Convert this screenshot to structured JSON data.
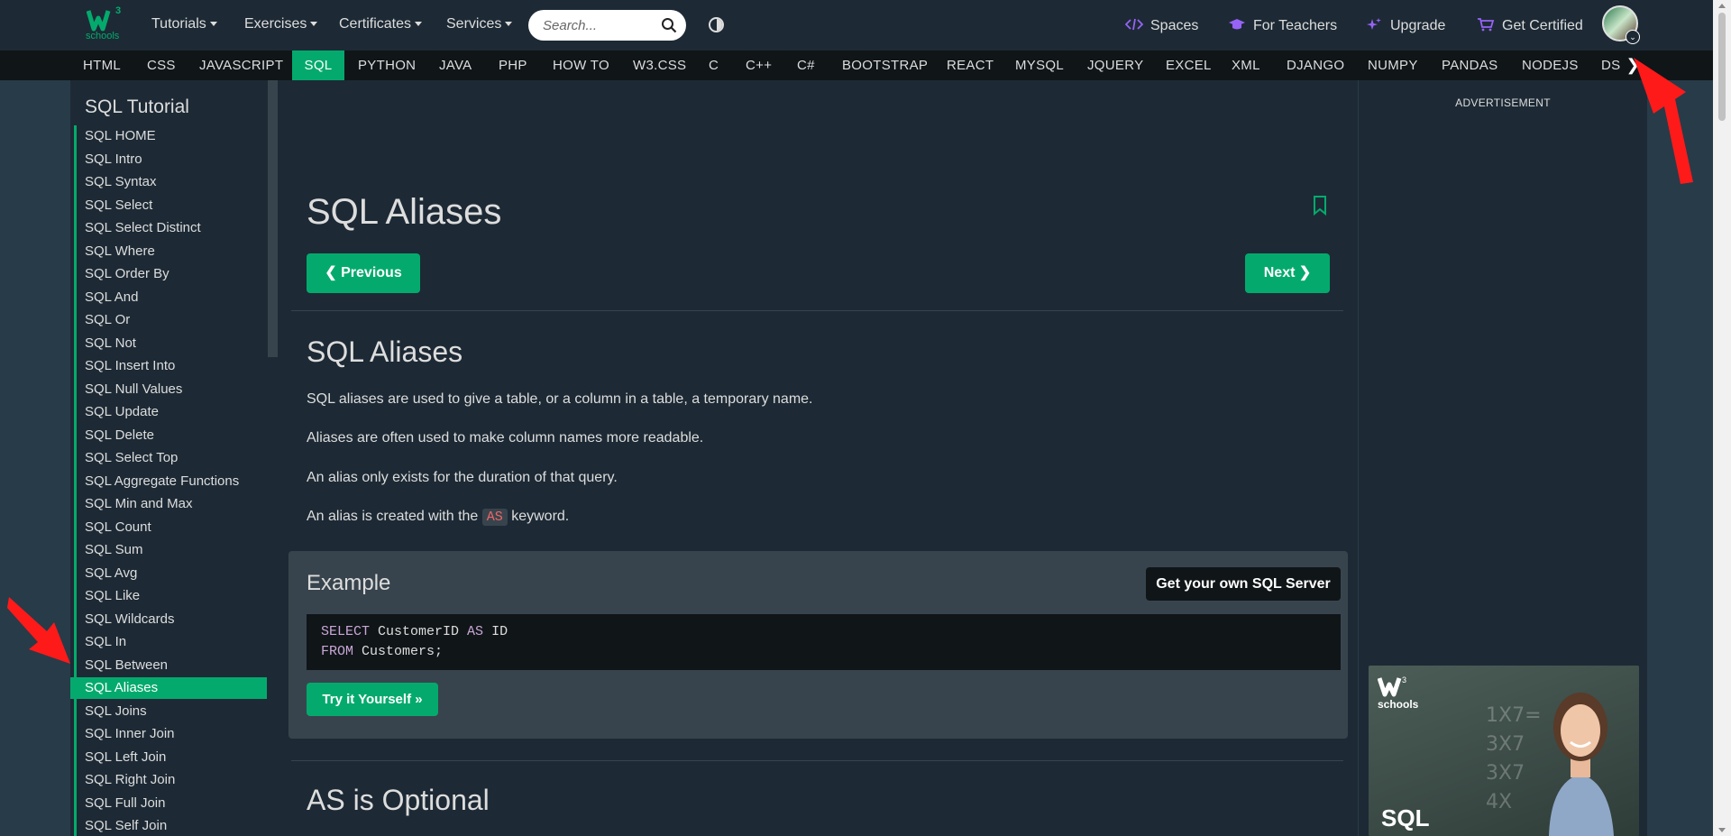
{
  "topnav": {
    "tutorials": "Tutorials",
    "exercises": "Exercises",
    "certificates": "Certificates",
    "services": "Services",
    "search_placeholder": "Search...",
    "spaces": "Spaces",
    "for_teachers": "For Teachers",
    "upgrade": "Upgrade",
    "get_certified": "Get Certified",
    "logo_sup": "3",
    "logo_text": "schools"
  },
  "langbar": {
    "items": [
      "HTML",
      "CSS",
      "JAVASCRIPT",
      "SQL",
      "PYTHON",
      "JAVA",
      "PHP",
      "HOW TO",
      "W3.CSS",
      "C",
      "C++",
      "C#",
      "BOOTSTRAP",
      "REACT",
      "MYSQL",
      "JQUERY",
      "EXCEL",
      "XML",
      "DJANGO",
      "NUMPY",
      "PANDAS",
      "NODEJS",
      "DS"
    ],
    "active": "SQL",
    "next_glyph": "❯"
  },
  "sidebar": {
    "title": "SQL Tutorial",
    "items": [
      "SQL HOME",
      "SQL Intro",
      "SQL Syntax",
      "SQL Select",
      "SQL Select Distinct",
      "SQL Where",
      "SQL Order By",
      "SQL And",
      "SQL Or",
      "SQL Not",
      "SQL Insert Into",
      "SQL Null Values",
      "SQL Update",
      "SQL Delete",
      "SQL Select Top",
      "SQL Aggregate Functions",
      "SQL Min and Max",
      "SQL Count",
      "SQL Sum",
      "SQL Avg",
      "SQL Like",
      "SQL Wildcards",
      "SQL In",
      "SQL Between",
      "SQL Aliases",
      "SQL Joins",
      "SQL Inner Join",
      "SQL Left Join",
      "SQL Right Join",
      "SQL Full Join",
      "SQL Self Join"
    ],
    "active": "SQL Aliases"
  },
  "main": {
    "page_title": "SQL Aliases",
    "prev_label": "❮ Previous",
    "next_label": "Next ❯",
    "section_title": "SQL Aliases",
    "p1": "SQL aliases are used to give a table, or a column in a table, a temporary name.",
    "p2": "Aliases are often used to make column names more readable.",
    "p3": "An alias only exists for the duration of that query.",
    "p4_before": "An alias is created with the ",
    "p4_keyword": "AS",
    "p4_after": " keyword.",
    "example": {
      "title": "Example",
      "server_button": "Get your own SQL Server",
      "code_line1_kw1": "SELECT",
      "code_line1_mid": " CustomerID ",
      "code_line1_kw2": "AS",
      "code_line1_end": " ID",
      "code_line2_kw": "FROM",
      "code_line2_rest": " Customers;",
      "try_label": "Try it Yourself »"
    },
    "section2_title": "AS is Optional"
  },
  "rightcol": {
    "ad_label": "ADVERTISEMENT",
    "promo_logo_sup": "3",
    "promo_logo_text": "schools",
    "promo_text": "SQL"
  },
  "colors": {
    "accent": "#04aa6d",
    "topbar": "#1d2a35",
    "langbar": "#101518",
    "annotation_arrow": "#ff1a1a"
  }
}
